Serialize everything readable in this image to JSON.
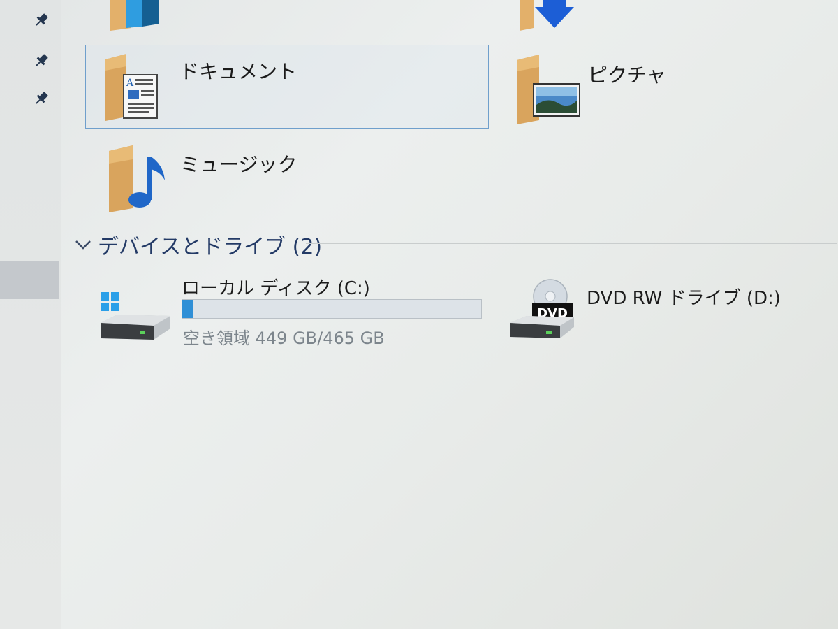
{
  "folders": [
    {
      "id": "documents",
      "label": "ドキュメント",
      "selected": true
    },
    {
      "id": "pictures",
      "label": "ピクチャ",
      "selected": false
    },
    {
      "id": "music",
      "label": "ミュージック",
      "selected": false
    }
  ],
  "devices_section": {
    "title": "デバイスとドライブ (2)"
  },
  "drives": [
    {
      "id": "c",
      "name": "ローカル ディスク (C:)",
      "free_text": "空き領域 449 GB/465 GB",
      "free_gb": 449,
      "total_gb": 465
    },
    {
      "id": "d",
      "name": "DVD RW ドライブ (D:)",
      "badge": "DVD"
    }
  ],
  "colors": {
    "accent": "#2f8fd6",
    "selection_border": "#6f9fcc",
    "section_title": "#233a66",
    "folder": "#e6b26a"
  }
}
